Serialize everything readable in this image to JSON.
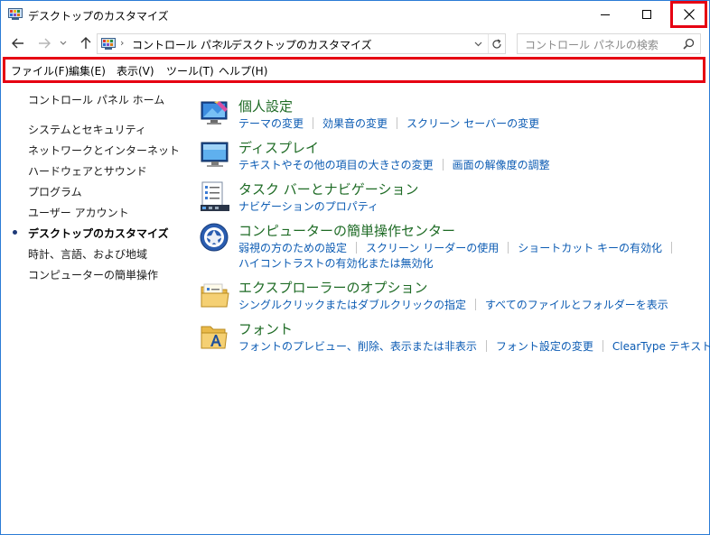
{
  "window": {
    "title": "デスクトップのカスタマイズ"
  },
  "address": {
    "crumbs": [
      "コントロール パネル",
      "デスクトップのカスタマイズ"
    ]
  },
  "search": {
    "placeholder": "コントロール パネルの検索"
  },
  "menu": {
    "items": [
      "ファイル(F)",
      "編集(E)",
      "表示(V)",
      "ツール(T)",
      "ヘルプ(H)"
    ]
  },
  "sidebar": {
    "home": "コントロール パネル ホーム",
    "items": [
      "システムとセキュリティ",
      "ネットワークとインターネット",
      "ハードウェアとサウンド",
      "プログラム",
      "ユーザー アカウント",
      "デスクトップのカスタマイズ",
      "時計、言語、および地域",
      "コンピューターの簡単操作"
    ],
    "current_index": 5
  },
  "sections": [
    {
      "title": "個人設定",
      "icon": "personalization-icon",
      "links": [
        [
          "テーマの変更",
          "効果音の変更",
          "スクリーン セーバーの変更"
        ]
      ]
    },
    {
      "title": "ディスプレイ",
      "icon": "display-icon",
      "links": [
        [
          "テキストやその他の項目の大きさの変更",
          "画面の解像度の調整"
        ]
      ]
    },
    {
      "title": "タスク バーとナビゲーション",
      "icon": "taskbar-icon",
      "links": [
        [
          "ナビゲーションのプロパティ"
        ]
      ]
    },
    {
      "title": "コンピューターの簡単操作センター",
      "icon": "ease-of-access-icon",
      "links": [
        [
          "弱視の方のための設定",
          "スクリーン リーダーの使用",
          "ショートカット キーの有効化"
        ],
        [
          "ハイコントラストの有効化または無効化"
        ]
      ]
    },
    {
      "title": "エクスプローラーのオプション",
      "icon": "folder-options-icon",
      "links": [
        [
          "シングルクリックまたはダブルクリックの指定",
          "すべてのファイルとフォルダーを表示"
        ]
      ]
    },
    {
      "title": "フォント",
      "icon": "fonts-icon",
      "links": [
        [
          "フォントのプレビュー、削除、表示または非表示",
          "フォント設定の変更",
          "ClearType テキストの調整"
        ]
      ]
    }
  ],
  "colors": {
    "accent_link": "#0b5bb3",
    "section_title": "#1e6b25",
    "highlight_frame": "#e60012"
  }
}
